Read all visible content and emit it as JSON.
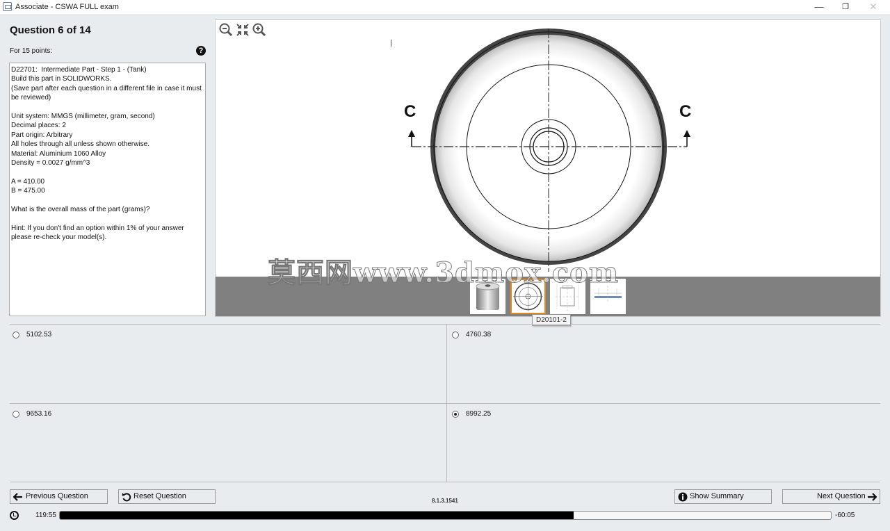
{
  "window": {
    "title": "Associate - CSWA FULL exam",
    "minimize_glyph": "—",
    "restore_glyph": "❐",
    "close_glyph": "✕"
  },
  "question": {
    "title": "Question 6 of 14",
    "points": "For 15 points:",
    "help_glyph": "?",
    "lines": [
      "D22701:  Intermediate Part - Step 1 - (Tank)",
      "Build this part in SOLIDWORKS.",
      "(Save part after each question in a different file in case it must be reviewed)",
      "",
      "Unit system: MMGS (millimeter, gram, second)",
      "Decimal places: 2",
      "Part origin: Arbitrary",
      "All holes through all unless shown otherwise.",
      "Material: Aluminium 1060 Alloy",
      "Density = 0.0027 g/mm^3",
      "",
      "A = 410.00",
      "B = 475.00",
      "",
      "What is the overall mass of the part (grams)?",
      "",
      "Hint: If you don't find an option within 1% of your answer please re-check your model(s)."
    ]
  },
  "viewer": {
    "section_label_left": "C",
    "section_label_right": "C",
    "tooltip": "D20101-2",
    "thumbnails": [
      "thumbnail-3d-view",
      "thumbnail-top-view",
      "thumbnail-front-section",
      "thumbnail-detail-view"
    ],
    "selected_thumbnail": 1,
    "watermark": "莫西网www.3dmox.com"
  },
  "answers": [
    {
      "value": "5102.53",
      "selected": false
    },
    {
      "value": "4760.38",
      "selected": false
    },
    {
      "value": "9653.16",
      "selected": false
    },
    {
      "value": "8992.25",
      "selected": true
    }
  ],
  "footer": {
    "previous": "Previous Question",
    "reset": "Reset Question",
    "version": "8.1.3.1541",
    "summary": "Show Summary",
    "next": "Next Question",
    "time_elapsed": "119:55",
    "time_remaining": "-60:05",
    "progress_fraction": 0.666
  },
  "colors": {
    "selected_thumb_border": "#e08a1e",
    "strip": "#808080"
  }
}
